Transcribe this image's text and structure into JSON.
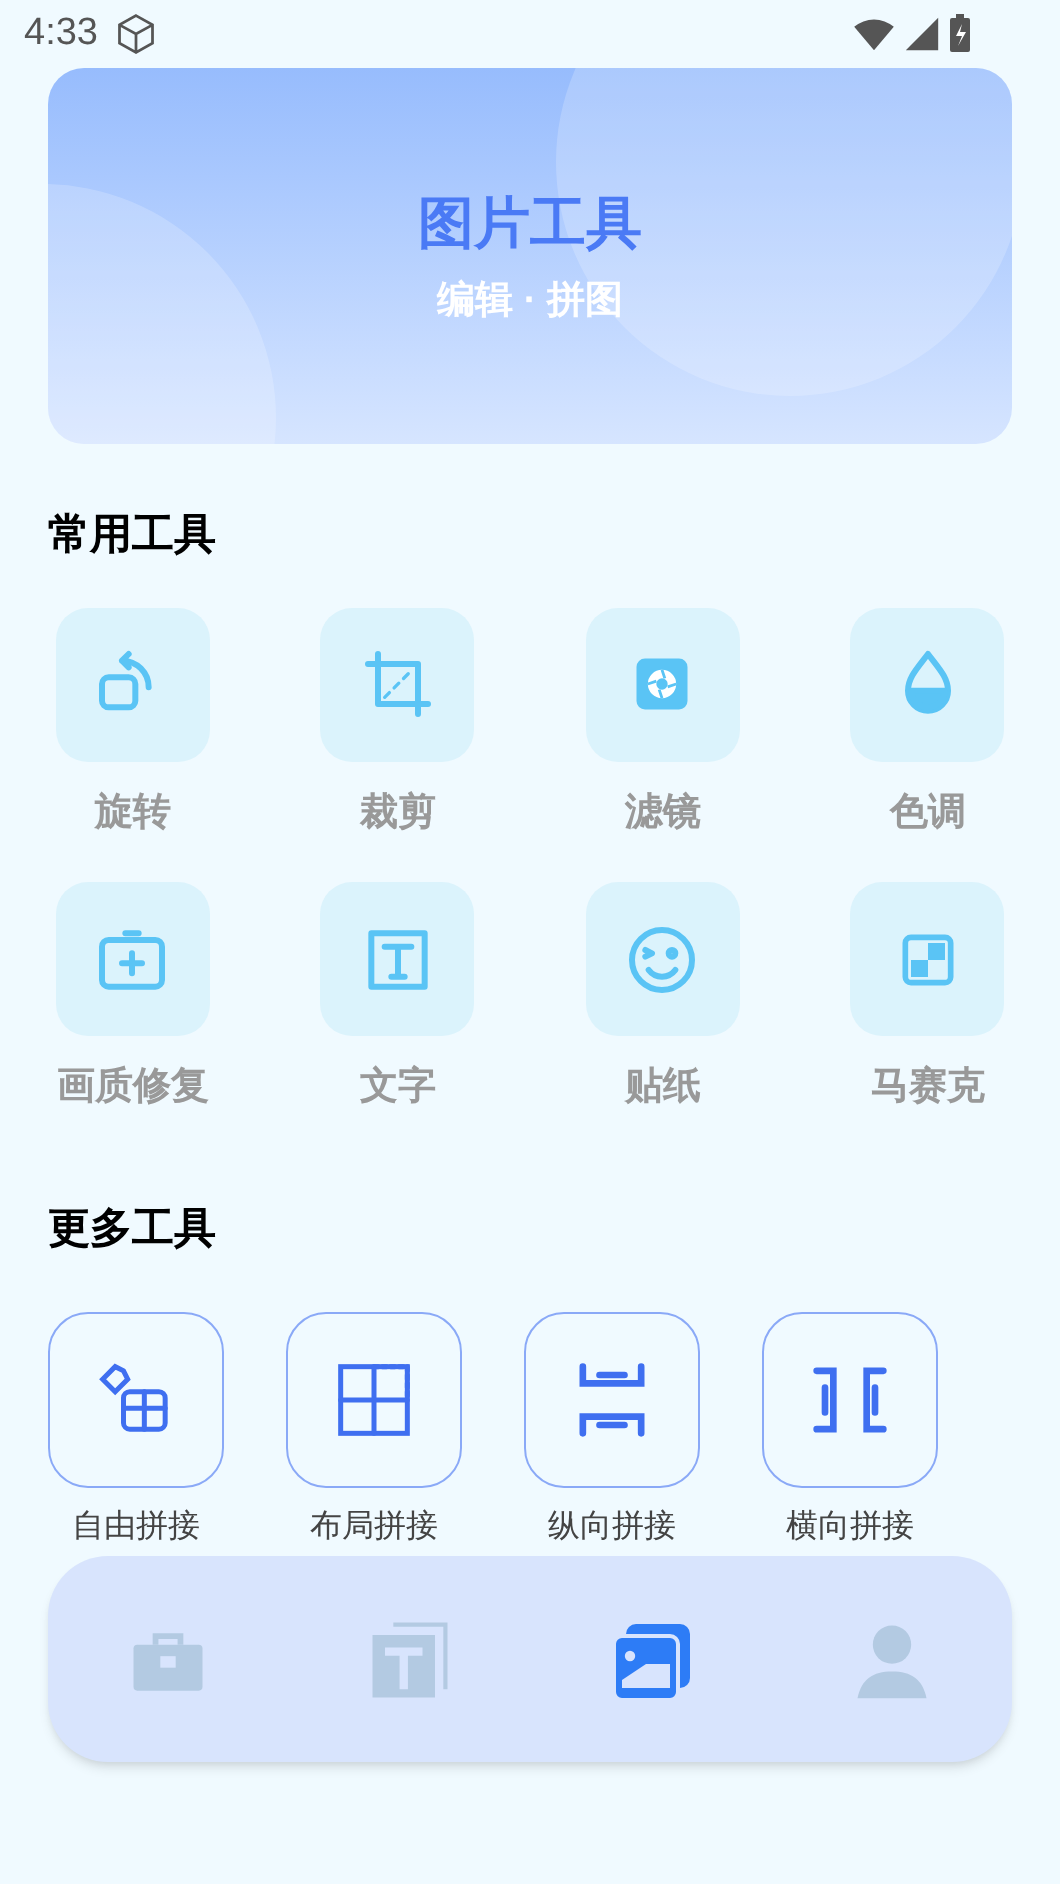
{
  "status_bar": {
    "time": "4:33"
  },
  "banner": {
    "title": "图片工具",
    "subtitle": "编辑 · 拼图"
  },
  "common_tools": {
    "title": "常用工具",
    "items": [
      {
        "kind": "rotate",
        "label": "旋转"
      },
      {
        "kind": "crop",
        "label": "裁剪"
      },
      {
        "kind": "filter",
        "label": "滤镜"
      },
      {
        "kind": "tone",
        "label": "色调"
      },
      {
        "kind": "restore",
        "label": "画质修复"
      },
      {
        "kind": "text",
        "label": "文字"
      },
      {
        "kind": "sticker",
        "label": "贴纸"
      },
      {
        "kind": "mosaic",
        "label": "马赛克"
      }
    ]
  },
  "more_tools": {
    "title": "更多工具",
    "items": [
      {
        "kind": "free",
        "label": "自由拼接"
      },
      {
        "kind": "layout",
        "label": "布局拼接"
      },
      {
        "kind": "vertical",
        "label": "纵向拼接"
      },
      {
        "kind": "horizontal",
        "label": "横向拼接"
      }
    ]
  },
  "bottom_nav": {
    "tabs": [
      {
        "kind": "toolbox",
        "selected": false
      },
      {
        "kind": "text",
        "selected": false
      },
      {
        "kind": "gallery",
        "selected": true
      },
      {
        "kind": "profile",
        "selected": false
      }
    ]
  }
}
